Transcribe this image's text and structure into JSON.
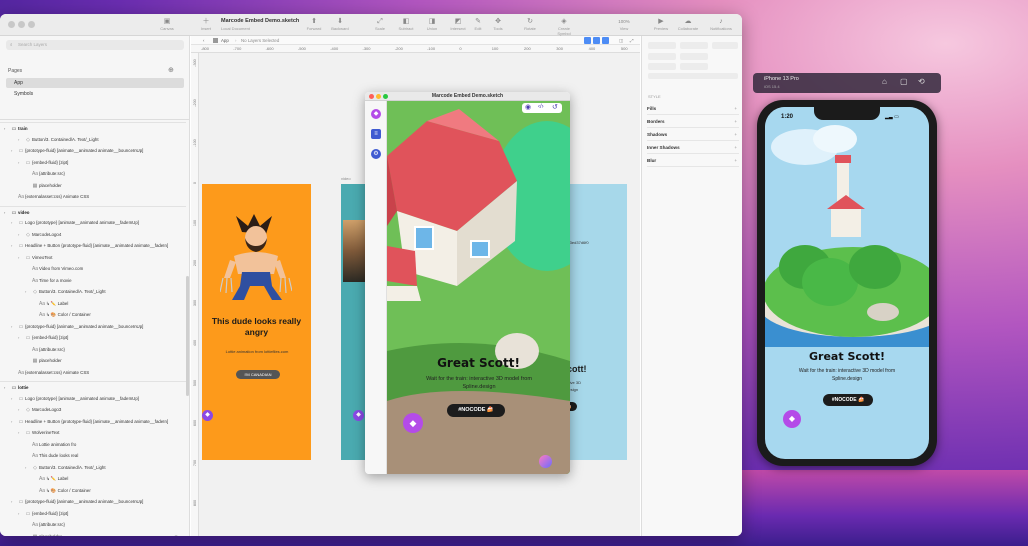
{
  "window": {
    "title": "Marcode Embed Demo.sketch",
    "subtitle": "Local Document",
    "toolbar": {
      "canvas": "Canvas",
      "insert": "Insert",
      "forward": "Forward",
      "backward": "Backward",
      "scale": "Scale",
      "subtract": "Subtract",
      "union": "Union",
      "intersect": "Intersect",
      "difference": "Difference",
      "edit": "Edit",
      "rotate": "Rotate",
      "symbol": "Create Symbol",
      "tools": "Tools",
      "zoom": "100%",
      "view": "View",
      "preview": "Preview",
      "collaborate": "Collaborate",
      "notifications": "Notifications"
    }
  },
  "layers_panel": {
    "search_placeholder": "Search Layers",
    "pages_label": "Pages",
    "pages": [
      "App",
      "Symbols"
    ],
    "rows": [
      {
        "text": "train",
        "indent": 0,
        "group": true,
        "icon": "folder-icon"
      },
      {
        "text": "Button/3. Contained/A. Text/_Light",
        "indent": 2,
        "icon": "symbol-icon"
      },
      {
        "text": "{prototype-fluid} [animate__animated animate__bounceInUp]",
        "indent": 1,
        "icon": "group-icon"
      },
      {
        "text": "{embed-fluid} [zipt]",
        "indent": 2,
        "icon": "group-icon"
      },
      {
        "text": "{attribute:src}",
        "indent": 3,
        "icon": "text-icon"
      },
      {
        "text": "placeholder",
        "indent": 3,
        "icon": "image-icon"
      },
      {
        "text": "{externalasset:css} Animate CSS",
        "indent": 1,
        "icon": "text-icon"
      },
      {
        "text": "video",
        "indent": 0,
        "group": true,
        "icon": "folder-icon"
      },
      {
        "text": "Logo {prototype} [animate__animated animate__fadeInUp]",
        "indent": 1,
        "icon": "group-icon"
      },
      {
        "text": "MarcodeLogo4",
        "indent": 2,
        "icon": "symbol-icon"
      },
      {
        "text": "Headline + Button {prototype-fluid} [animate__animated animate__fadeIn]",
        "indent": 1,
        "icon": "group-icon"
      },
      {
        "text": "VimeoText",
        "indent": 2,
        "icon": "group-icon"
      },
      {
        "text": "Video from Vimeo.com",
        "indent": 3,
        "icon": "text-icon"
      },
      {
        "text": "Time for a movie",
        "indent": 3,
        "icon": "text-icon"
      },
      {
        "text": "Button/3. Contained/A. Text/_Light",
        "indent": 3,
        "icon": "symbol-icon"
      },
      {
        "text": "↳ ✏️ Label",
        "indent": 4,
        "icon": "text-icon"
      },
      {
        "text": "↳ 🎨 Color / Container",
        "indent": 4,
        "icon": "text-icon"
      },
      {
        "text": "{prototype-fluid} [animate__animated animate__bounceInUp]",
        "indent": 1,
        "icon": "group-icon"
      },
      {
        "text": "{embed-fluid} [zipt]",
        "indent": 2,
        "icon": "group-icon"
      },
      {
        "text": "{attribute:src}",
        "indent": 3,
        "icon": "text-icon"
      },
      {
        "text": "placeholder",
        "indent": 3,
        "icon": "image-icon"
      },
      {
        "text": "{externalasset:css} Animate CSS",
        "indent": 1,
        "icon": "text-icon"
      },
      {
        "text": "lottie",
        "indent": 0,
        "group": true,
        "icon": "folder-icon"
      },
      {
        "text": "Logo {prototype} [animate__animated animate__fadeInUp]",
        "indent": 1,
        "icon": "group-icon"
      },
      {
        "text": "MarcodeLogo3",
        "indent": 2,
        "icon": "symbol-icon"
      },
      {
        "text": "Headline + Button {prototype-fluid} [animate__animated animate__fadeIn]",
        "indent": 1,
        "icon": "group-icon"
      },
      {
        "text": "WolverineText",
        "indent": 2,
        "icon": "group-icon"
      },
      {
        "text": "Lottie animation fro",
        "indent": 3,
        "icon": "text-icon"
      },
      {
        "text": "This dude looks real",
        "indent": 3,
        "icon": "text-icon"
      },
      {
        "text": "Button/3. Contained/A. Text/_Light",
        "indent": 3,
        "icon": "symbol-icon"
      },
      {
        "text": "↳ ✏️ Label",
        "indent": 4,
        "icon": "text-icon"
      },
      {
        "text": "↳ 🎨 Color / Container",
        "indent": 4,
        "icon": "text-icon"
      },
      {
        "text": "{prototype-fluid} [animate__animated animate__bounceInUp]",
        "indent": 1,
        "icon": "group-icon"
      },
      {
        "text": "{embed-fluid} [zipt]",
        "indent": 2,
        "icon": "group-icon"
      },
      {
        "text": "{attribute:src}",
        "indent": 3,
        "icon": "text-icon"
      },
      {
        "text": "placeholder",
        "indent": 3,
        "icon": "image-icon"
      },
      {
        "text": "{externalasset:css} Animate CSS",
        "indent": 1,
        "icon": "text-icon"
      }
    ]
  },
  "canvas": {
    "breadcrumb_page": "App",
    "breadcrumb_state": "No Layers Selected",
    "ruler_h": [
      "-800",
      "-700",
      "-600",
      "-500",
      "-400",
      "-300",
      "-200",
      "-100",
      "0",
      "100",
      "200",
      "300",
      "400",
      "500",
      "600",
      "700",
      "800",
      "900",
      "1 000",
      "1 100",
      "1 200",
      "1 300",
      "1 400",
      "1 500",
      "1 600",
      "1 700",
      "1 800"
    ],
    "ruler_v": [
      "-300",
      "-200",
      "-100",
      "0",
      "100",
      "200",
      "300",
      "400",
      "500",
      "600",
      "700",
      "800"
    ],
    "artboard_video_label": "video",
    "lottie_card": {
      "headline": "This dude looks really angry",
      "sub": "Lottie animation from lottiefiles.com",
      "button": "I'M CANADIAN"
    },
    "train_card": {
      "line1": "ign/",
      "line2": "b763ed37d6f0",
      "headline": "Scott!",
      "sub1": "ractive 3D",
      "sub2": "e.design"
    }
  },
  "embed_window": {
    "title": "Marcode Embed Demo.sketch",
    "headline": "Great Scott!",
    "sub": "Wait for the train: interactive 3D model from Spline.design",
    "button": "#NOCODE 🍰"
  },
  "inspector": {
    "style_label": "STYLE",
    "sections": [
      "Fills",
      "Borders",
      "Shadows",
      "Inner Shadows",
      "Blur"
    ]
  },
  "simulator": {
    "device": "iPhone 13 Pro",
    "os": "iOS 15.4",
    "time": "1:20",
    "headline": "Great Scott!",
    "sub": "Wait for the train: interactive 3D model from Spline.design",
    "button": "#NOCODE 🍰"
  },
  "colors": {
    "orange_artboard": "#fd9a1b",
    "teal_artboard": "#4aaab0",
    "sky_artboard": "#a7d8ea",
    "accent_blue": "#4d8cf5",
    "roof_red": "#e0535b"
  }
}
